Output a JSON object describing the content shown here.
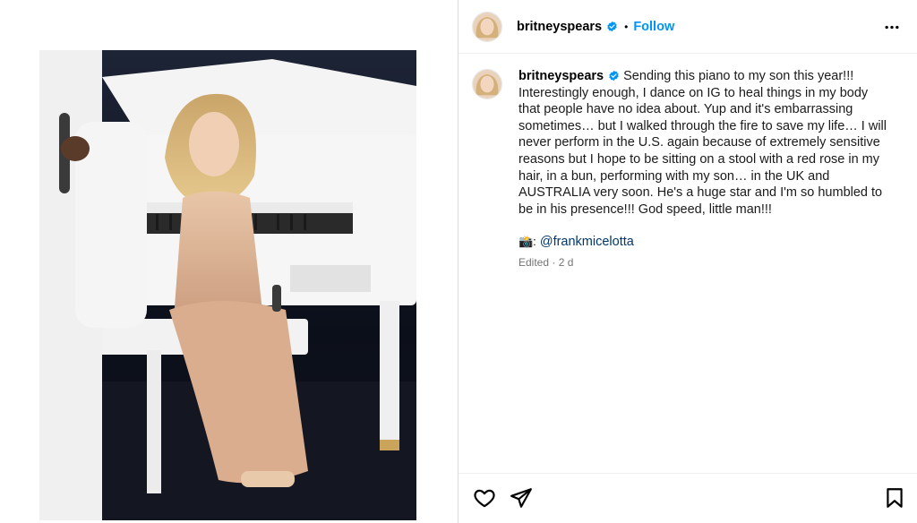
{
  "post": {
    "author": "britneyspears",
    "follow_label": "Follow",
    "separator": "•",
    "caption": "Sending this piano to my son this year!!! Interestingly enough, I dance on IG to heal things in my body that people have no idea about. Yup and it's embarrassing sometimes… but I walked through the fire to save my life… I will never perform in the U.S. again because of extremely sensitive reasons but I hope to be sitting on a stool with a red rose in my hair, in a bun, performing with my son… in the UK and AUSTRALIA very soon. He's a huge star and I'm so humbled to be in his presence!!! God speed, little man!!!",
    "credit_emoji": "📸:",
    "credit_handle": "@frankmicelotta",
    "edited_label": "Edited",
    "meta_separator": "·",
    "timestamp": "2 d"
  },
  "icons": {
    "verified": "verified-badge-icon",
    "more": "more-options-icon",
    "like": "heart-icon",
    "share": "share-paper-plane-icon",
    "save": "bookmark-icon"
  },
  "colors": {
    "follow_blue": "#0095f6",
    "verified_blue": "#0095f6",
    "link_blue": "#00376b",
    "meta_gray": "#737373"
  }
}
